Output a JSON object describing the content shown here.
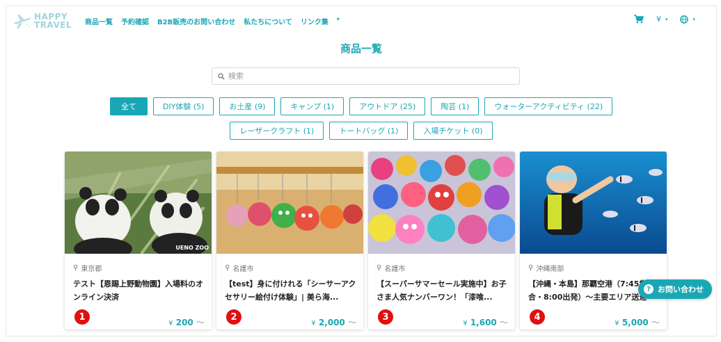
{
  "brand": {
    "logo_line1": "HAPPY",
    "logo_line2": "TRAVEL"
  },
  "nav": {
    "items": [
      "商品一覧",
      "予約確認",
      "B2B販売のお問い合わせ",
      "私たちについて",
      "リンク集"
    ],
    "more_caret": "▾"
  },
  "header_right": {
    "cart_icon": "cart-icon",
    "currency": "¥",
    "language_icon": "globe-icon",
    "caret": "▾"
  },
  "page_title": "商品一覧",
  "search": {
    "placeholder": "検索"
  },
  "filters": {
    "row1": [
      "全て",
      "DIY体験 (5)",
      "お土産 (9)",
      "キャンプ (1)",
      "アウトドア (25)",
      "陶芸 (1)",
      "ウォーターアクティビティ (22)"
    ],
    "row2": [
      "レーザークラフト (1)",
      "トートバッグ (1)",
      "入場チケット (0)"
    ],
    "active": "全て"
  },
  "cards": [
    {
      "number": "1",
      "location": "東京都",
      "title": "テスト【恩賜上野動物園】入場料のオンライン決済",
      "price": "200",
      "watermark": "UENO ZOO"
    },
    {
      "number": "2",
      "location": "名護市",
      "title": "【test】身に付けれる「シーサーアクセサリー絵付け体験」| 美ら海...",
      "price": "2,000"
    },
    {
      "number": "3",
      "location": "名護市",
      "title": "【スーパーサマーセール実施中】お子さま人気ナンバーワン！「漆喰...",
      "price": "1,600"
    },
    {
      "number": "4",
      "location": "沖縄南部",
      "title": "【沖縄・本島】那覇空港（7:45集合・8:00出発）〜主要エリア送迎",
      "price": "5,000"
    }
  ],
  "price_prefix": "¥",
  "price_suffix": "〜",
  "contact_button": {
    "label": "お問い合わせ"
  },
  "colors": {
    "accent": "#1aa7b5",
    "badge": "#e01010"
  }
}
